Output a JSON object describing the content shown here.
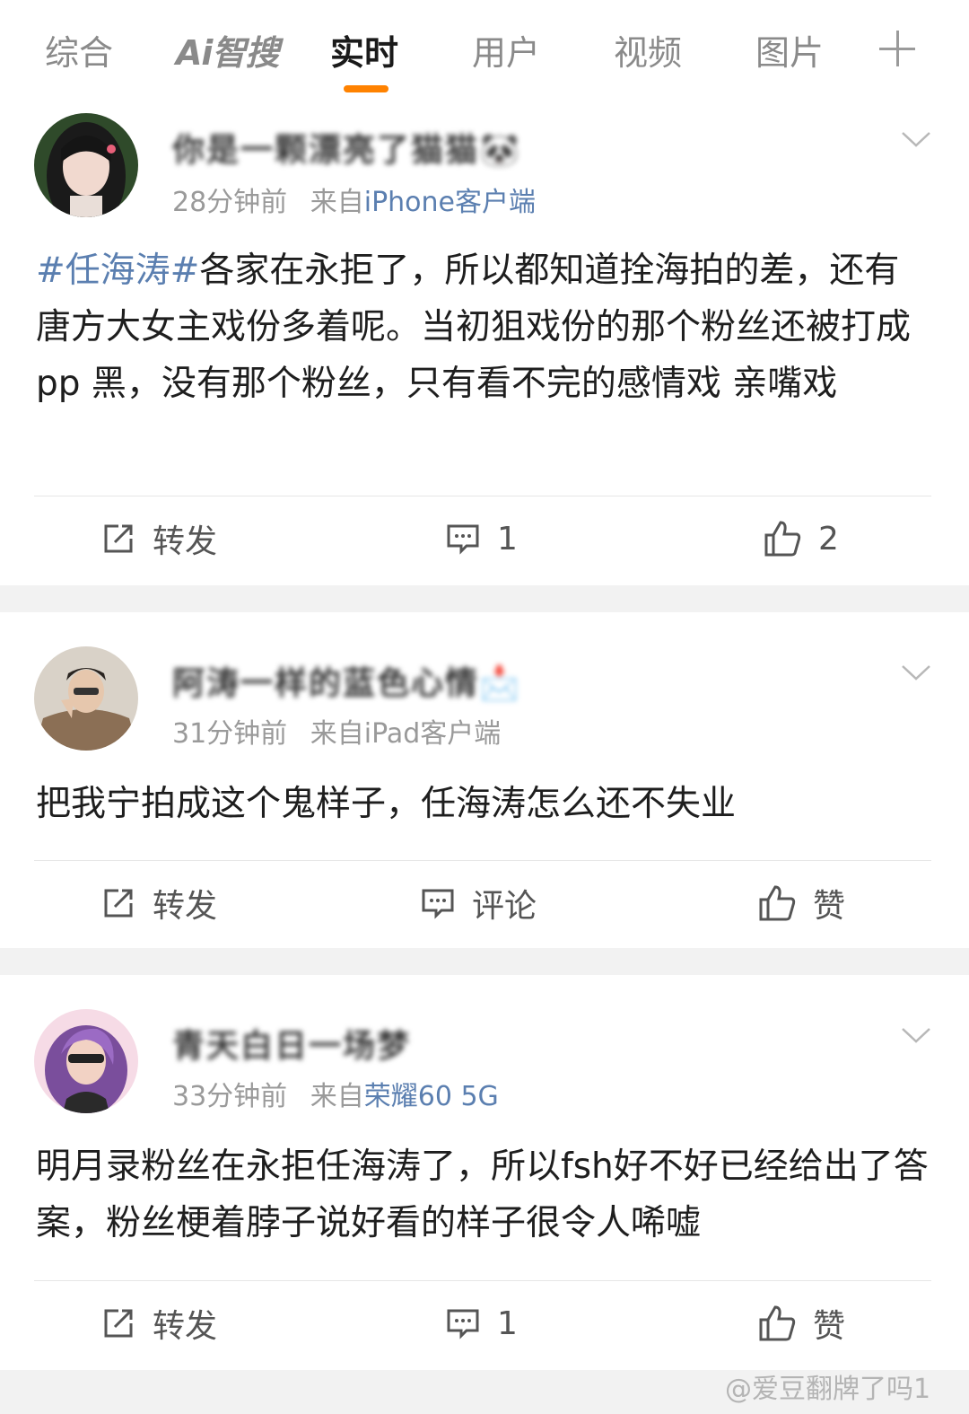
{
  "tabs": [
    {
      "label": "综合"
    },
    {
      "label": "Ai智搜"
    },
    {
      "label": "实时"
    },
    {
      "label": "用户"
    },
    {
      "label": "视频"
    },
    {
      "label": "图片"
    }
  ],
  "accent_color": "#ff8200",
  "link_color": "#5b7fb0",
  "posts": [
    {
      "username": "你是一颗漂亮了猫猫🐼",
      "time": "28分钟前",
      "source_prefix": "来自",
      "source": "iPhone客户端",
      "hashtag": "#任海涛#",
      "text": "各家在永拒了，所以都知道拴海拍的差，还有 唐方大女主戏份多着呢。当初狙戏份的那个粉丝还被打成pp 黑，没有那个粉丝，只有看不完的感情戏 亲嘴戏",
      "repost_label": "转发",
      "comment_label": "1",
      "like_label": "2"
    },
    {
      "username": "阿涛一样的蓝色心情📩",
      "time": "31分钟前",
      "source_prefix": "来自",
      "source": "iPad客户端",
      "text": "把我宁拍成这个鬼样子，任海涛怎么还不失业",
      "repost_label": "转发",
      "comment_label": "评论",
      "like_label": "赞"
    },
    {
      "username": "青天白日一场梦",
      "time": "33分钟前",
      "source_prefix": "来自",
      "source": "荣耀60 5G",
      "text": "明月录粉丝在永拒任海涛了，所以fsh好不好已经给出了答案，粉丝梗着脖子说好看的样子很令人唏嘘",
      "repost_label": "转发",
      "comment_label": "1",
      "like_label": "赞"
    }
  ],
  "watermark": "@爱豆翻牌了吗1"
}
